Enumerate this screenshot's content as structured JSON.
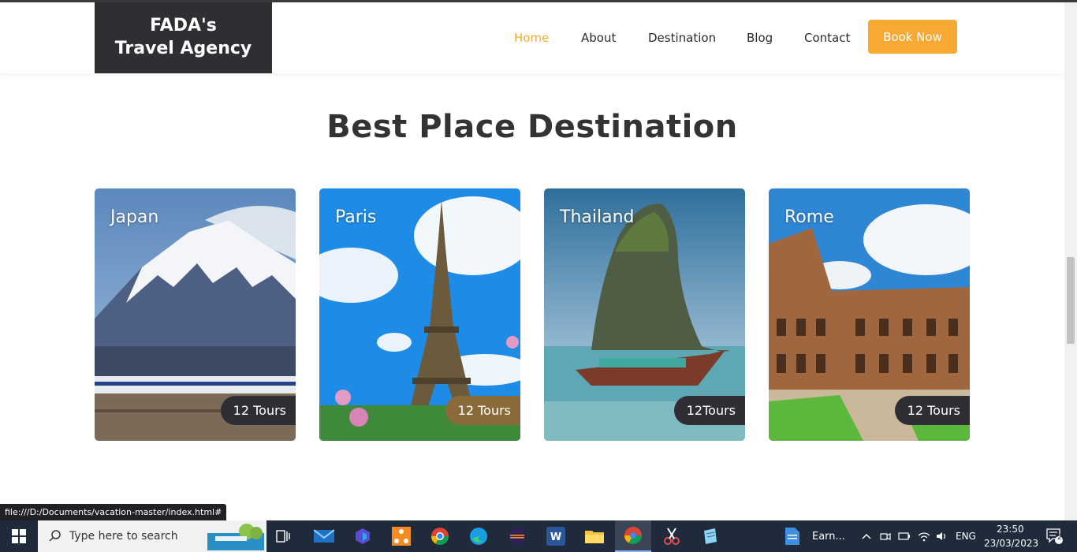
{
  "logo": {
    "line1": "FADA's",
    "line2": "Travel Agency"
  },
  "nav": {
    "items": [
      {
        "label": "Home",
        "active": true
      },
      {
        "label": "About",
        "active": false
      },
      {
        "label": "Destination",
        "active": false
      },
      {
        "label": "Blog",
        "active": false
      },
      {
        "label": "Contact",
        "active": false
      }
    ],
    "book_label": "Book Now"
  },
  "section": {
    "title": "Best Place Destination"
  },
  "destinations": [
    {
      "name": "Japan",
      "tours": "12 Tours"
    },
    {
      "name": "Paris",
      "tours": "12 Tours"
    },
    {
      "name": "Thailand",
      "tours": "12Tours"
    },
    {
      "name": "Rome",
      "tours": "12 Tours"
    }
  ],
  "status_url": "file:///D:/Documents/vacation-master/index.html#",
  "taskbar": {
    "search_placeholder": "Type here to search",
    "pinned_app_label": "Earn...",
    "language": "ENG",
    "time": "23:50",
    "date": "23/03/2023",
    "notification_count": "2"
  },
  "colors": {
    "accent": "#f8a933",
    "logo_bg": "#2f2e33",
    "taskbar_bg": "#1f2a3a"
  }
}
